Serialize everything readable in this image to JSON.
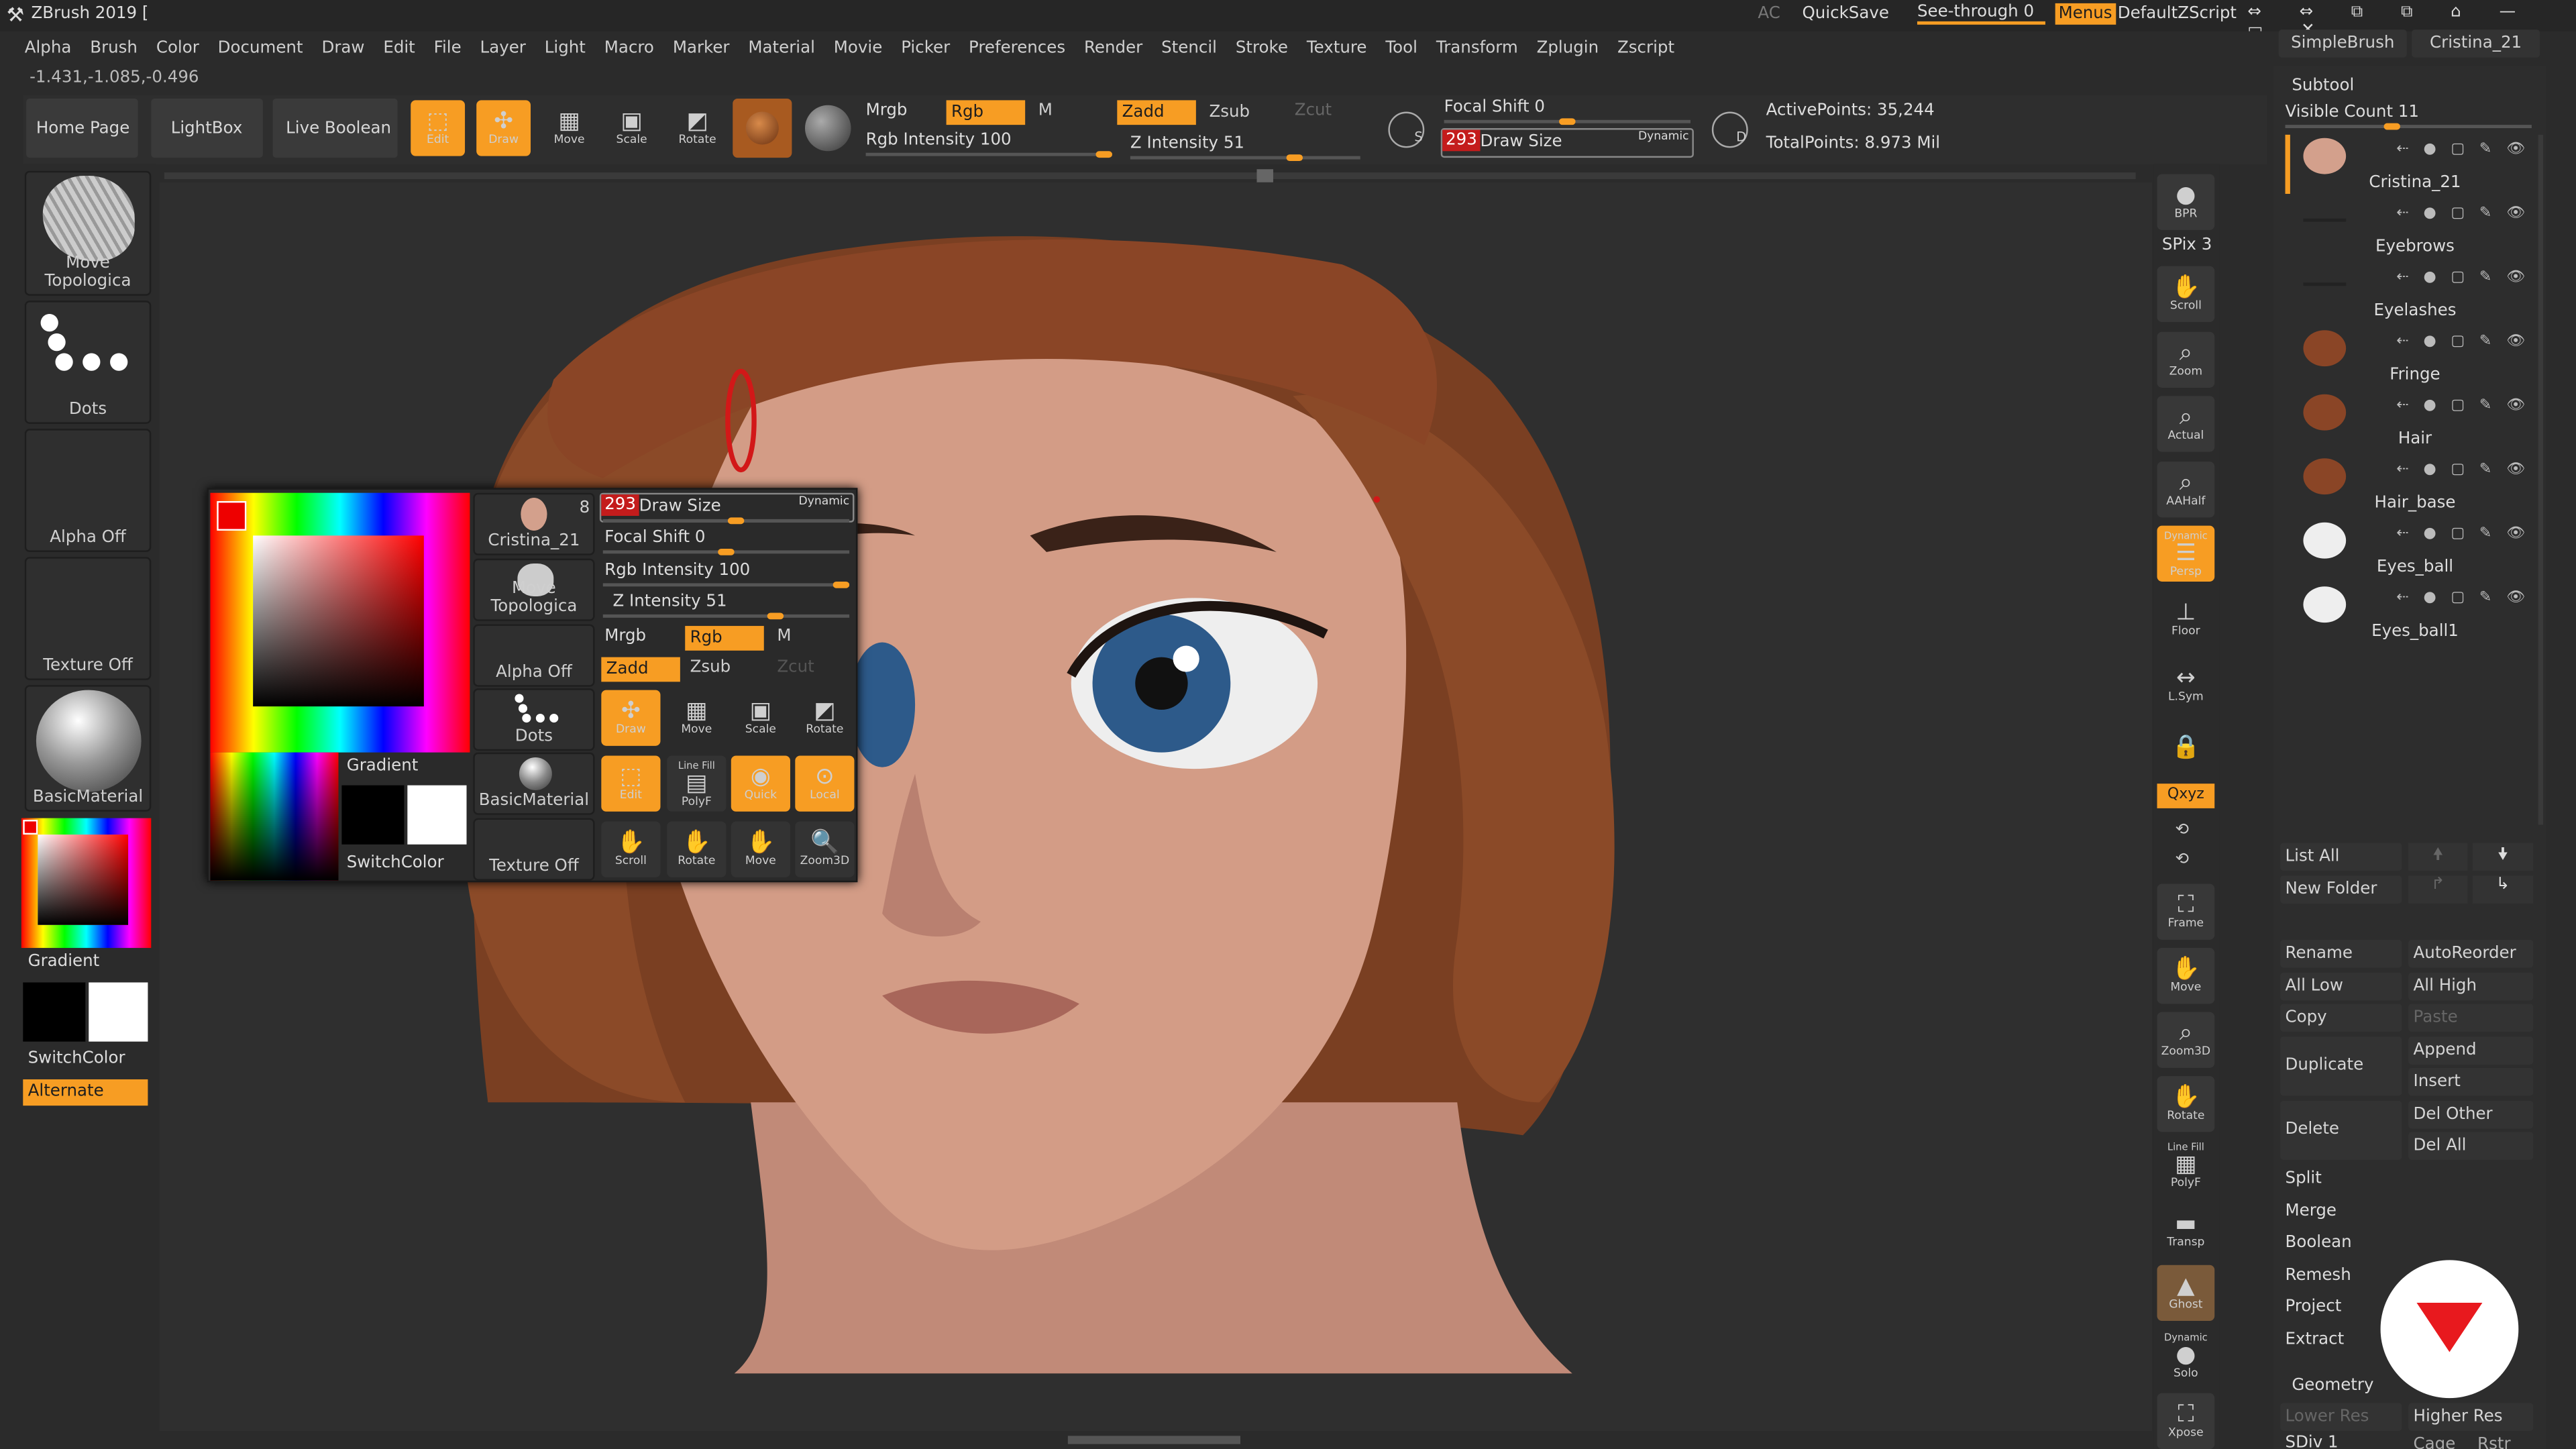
{
  "window": {
    "title": "ZBrush 2019 [",
    "ac": "AC",
    "quicksave": "QuickSave",
    "see_through": "See-through  0",
    "menus": "Menus",
    "script": "DefaultZScript"
  },
  "top_right": {
    "simple_brush": "SimpleBrush",
    "tool_name": "Cristina_21"
  },
  "menu": [
    "Alpha",
    "Brush",
    "Color",
    "Document",
    "Draw",
    "Edit",
    "File",
    "Layer",
    "Light",
    "Macro",
    "Marker",
    "Material",
    "Movie",
    "Picker",
    "Preferences",
    "Render",
    "Stencil",
    "Stroke",
    "Texture",
    "Tool",
    "Transform",
    "Zplugin",
    "Zscript"
  ],
  "coords": "-1.431,-1.085,-0.496",
  "shelf": {
    "home_page": "Home Page",
    "lightbox": "LightBox",
    "live_boolean": "Live Boolean",
    "edit": "Edit",
    "draw": "Draw",
    "move": "Move",
    "scale": "Scale",
    "rotate": "Rotate"
  },
  "brush_settings": {
    "mrgb": "Mrgb",
    "rgb": "Rgb",
    "m": "M",
    "zadd": "Zadd",
    "zsub": "Zsub",
    "zcut": "Zcut",
    "rgb_intensity": "Rgb Intensity 100",
    "z_intensity": "Z Intensity 51",
    "focal_shift": "Focal Shift 0",
    "draw_size_value": "293",
    "draw_size": "Draw Size",
    "dynamic": "Dynamic",
    "active_points": "ActivePoints: 35,244",
    "total_points": "TotalPoints: 8.973 Mil",
    "focal_key": "S",
    "drawsize_key": "D"
  },
  "left_shelf": {
    "brush": "Move Topologica",
    "stroke": "Dots",
    "alpha": "Alpha Off",
    "texture": "Texture Off",
    "material": "BasicMaterial",
    "gradient": "Gradient",
    "switch_color": "SwitchColor",
    "alternate": "Alternate"
  },
  "popup": {
    "tool_count": "8",
    "tool_name": "Cristina_21",
    "brush": "Move Topologica",
    "alpha": "Alpha Off",
    "stroke": "Dots",
    "material": "BasicMaterial",
    "texture": "Texture Off",
    "gradient": "Gradient",
    "switch_color": "SwitchColor",
    "draw_size_value": "293",
    "draw_size": "Draw Size",
    "dynamic": "Dynamic",
    "focal_shift": "Focal Shift 0",
    "rgb_intensity": "Rgb Intensity 100",
    "z_intensity": "Z Intensity 51",
    "mrgb": "Mrgb",
    "rgb": "Rgb",
    "m": "M",
    "zadd": "Zadd",
    "zsub": "Zsub",
    "zcut": "Zcut",
    "draw": "Draw",
    "move": "Move",
    "scale": "Scale",
    "rotate": "Rotate",
    "edit": "Edit",
    "polyf": "PolyF",
    "line_fill": "Line Fill",
    "quick": "Quick",
    "local": "Local",
    "scroll": "Scroll",
    "rotate2": "Rotate",
    "move2": "Move",
    "zoom3d": "Zoom3D"
  },
  "right_shelf": {
    "bpr": "BPR",
    "spix": "SPix 3",
    "scroll": "Scroll",
    "zoom": "Zoom",
    "actual": "Actual",
    "aahalf": "AAHalf",
    "dynamic": "Dynamic",
    "persp": "Persp",
    "floor": "Floor",
    "lsym": "L.Sym",
    "xyz": "Qxyz",
    "frame": "Frame",
    "move": "Move",
    "zoom3d": "Zoom3D",
    "rotate": "Rotate",
    "line_fill": "Line Fill",
    "polyf": "PolyF",
    "transp": "Transp",
    "ghost": "Ghost",
    "solo": "Solo",
    "xpose": "Xpose"
  },
  "subtool": {
    "header": "Subtool",
    "visible_count": "Visible Count 11",
    "items": [
      "Cristina_21",
      "Eyebrows",
      "Eyelashes",
      "Fringe",
      "Hair",
      "Hair_base",
      "Eyes_ball",
      "Eyes_ball1"
    ],
    "list_all": "List All",
    "new_folder": "New Folder",
    "rename": "Rename",
    "auto_reorder": "AutoReorder",
    "all_low": "All Low",
    "all_high": "All High",
    "copy": "Copy",
    "paste": "Paste",
    "duplicate": "Duplicate",
    "append": "Append",
    "insert": "Insert",
    "delete": "Delete",
    "del_other": "Del Other",
    "del_all": "Del All",
    "split": "Split",
    "merge": "Merge",
    "boolean": "Boolean",
    "remesh": "Remesh",
    "project": "Project",
    "extract": "Extract"
  },
  "geometry": {
    "header": "Geometry",
    "lower_res": "Lower Res",
    "higher_res": "Higher Res",
    "sdiv": "SDiv 1",
    "cage": "Cage",
    "rstr": "Rstr"
  },
  "colors": {
    "accent": "#f79d23",
    "bg": "#2b2b2b",
    "panel": "#333333",
    "skin": "#c98f7a",
    "hair": "#8a4a2a",
    "logo": "#e8191e"
  }
}
